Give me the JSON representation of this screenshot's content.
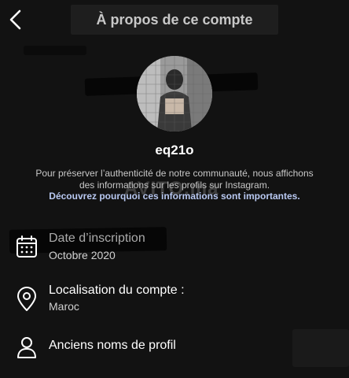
{
  "header": {
    "title": "À propos de ce compte",
    "back_icon": "chevron-left-icon"
  },
  "profile": {
    "username": "eq21o",
    "avatar_desc_icon": "profile-photo"
  },
  "info": {
    "description": "Pour préserver l’authenticité de notre communauté, nous affichons des informations sur les profils sur Instagram.",
    "learn_more": "Découvrez pourquoi ces informations sont importantes.",
    "link_color": "#b9c9f2"
  },
  "watermark": "AVITO.ma",
  "rows": [
    {
      "icon": "calendar-icon",
      "label": "Date d’inscription",
      "value": "Octobre 2020"
    },
    {
      "icon": "location-pin-icon",
      "label": "Localisation du compte :",
      "value": "Maroc"
    },
    {
      "icon": "person-icon",
      "label": "Anciens noms de profil",
      "value": ""
    }
  ],
  "colors": {
    "background": "#121212",
    "text": "#ffffff",
    "secondary_text": "#c8c8c8"
  }
}
